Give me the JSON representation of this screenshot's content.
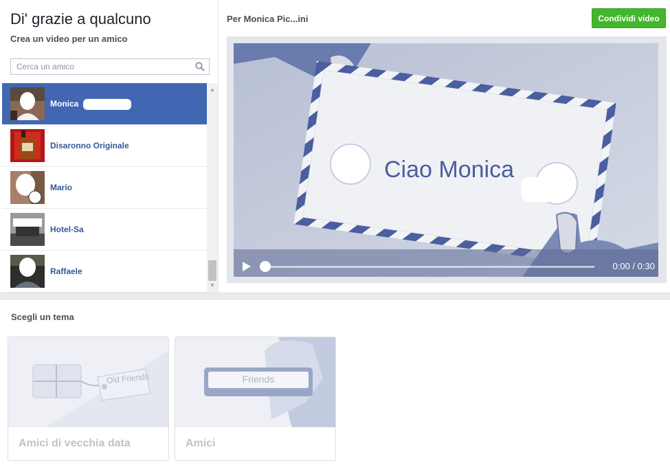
{
  "header": {
    "title": "Di' grazie a qualcuno",
    "subtitle": "Crea un video per un amico"
  },
  "search": {
    "placeholder": "Cerca un amico",
    "value": ""
  },
  "friends": [
    {
      "name": "Monica",
      "selected": true
    },
    {
      "name": "Disaronno Originale",
      "selected": false
    },
    {
      "name": "Mario",
      "selected": false
    },
    {
      "name": "Hotel-Sa",
      "selected": false
    },
    {
      "name": "Raffaele",
      "selected": false
    }
  ],
  "preview": {
    "title": "Per Monica Pic...ini",
    "share_label": "Condividi video",
    "video_text": "Ciao Monica",
    "time": "0:00 / 0:30"
  },
  "themes": {
    "heading": "Scegli un tema",
    "items": [
      {
        "label": "Amici di vecchia data",
        "tag_text": "Old Friends"
      },
      {
        "label": "Amici",
        "tag_text": "Friends"
      }
    ]
  },
  "colors": {
    "brand_blue": "#4267b2",
    "link_blue": "#365899",
    "share_green": "#42b72a",
    "envelope_stripe": "#4a5ea0"
  }
}
